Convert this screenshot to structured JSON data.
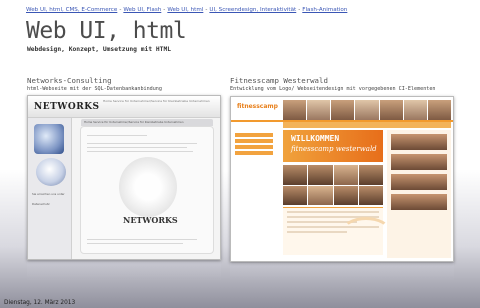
{
  "nav": {
    "items": [
      "Web UI, html, CMS, E-Commerce",
      "Web UI, Flash",
      "Web UI, html",
      "UI, Screendesign, Interaktivität",
      "Flash-Animation"
    ]
  },
  "header": {
    "title": "Web UI, html",
    "subtitle": "Webdesign, Konzept, Umsetzung mit HTML"
  },
  "projects": [
    {
      "title": "Networks-Consulting",
      "description": "html-Webseite mit der SQL-Datenbankanbindung",
      "shot": {
        "logo": "NETWORKS",
        "tagline": "Home  Service für Unternehmer/Service für Kleinbetriebe Unternehmen",
        "nav": "Home  Service für Unternehmer/Service für Kleinbetriebe Unternehmen",
        "watermark": "NETWORKS",
        "side_text": [
          "Sie erreichen uns unter",
          "Datenschutz"
        ]
      }
    },
    {
      "title": "Fitnesscamp Westerwald",
      "description": "Entwicklung vom Logo/ Webseitendesign mit vorgegebenen CI-Elementen",
      "shot": {
        "logo": "fitnesscamp",
        "banner_line1": "WILLKOMMEN",
        "banner_line2": "fitnesscamp westerwald"
      }
    }
  ],
  "footer": {
    "date": "Dienstag, 12. März 2013"
  },
  "colors": {
    "link": "#3a56b5",
    "accent_orange": "#f29a2e"
  }
}
